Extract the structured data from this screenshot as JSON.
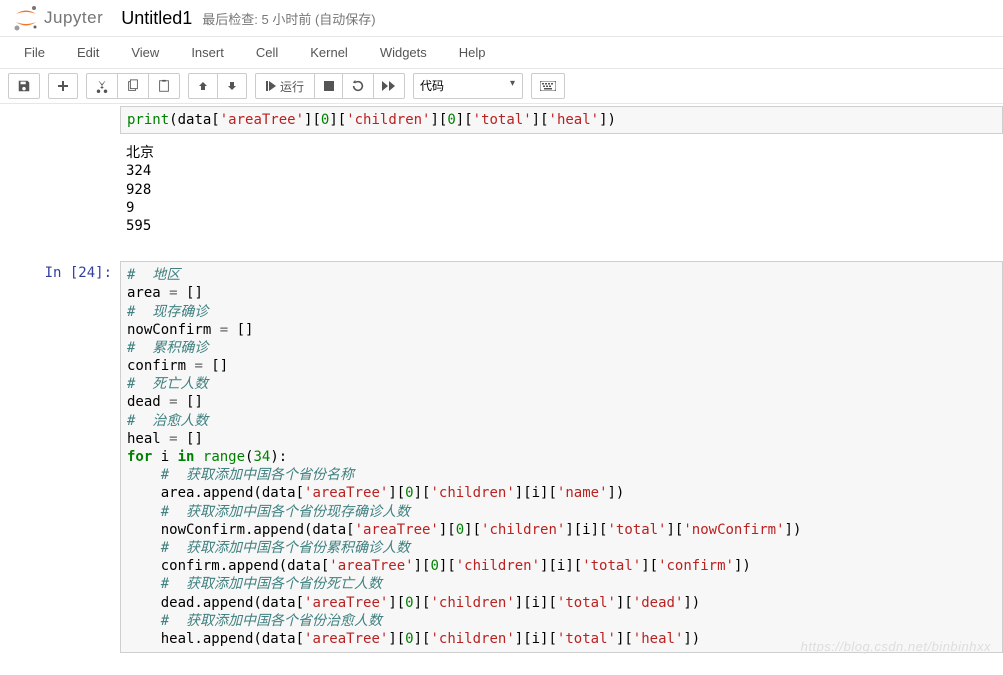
{
  "header": {
    "logo_text": "Jupyter",
    "notebook_name": "Untitled1",
    "checkpoint": "最后检查: 5 小时前   (自动保存)"
  },
  "menubar": [
    "File",
    "Edit",
    "View",
    "Insert",
    "Cell",
    "Kernel",
    "Widgets",
    "Help"
  ],
  "toolbar": {
    "run_label": "运行",
    "cell_type": "代码"
  },
  "cells": [
    {
      "type": "code_fragment",
      "code_html": "<span class='py-builtin'>print</span>(data[<span class='py-string'>'areaTree'</span>][<span class='py-number'>0</span>][<span class='py-string'>'children'</span>][<span class='py-number'>0</span>][<span class='py-string'>'total'</span>][<span class='py-string'>'heal'</span>])",
      "output": "北京\n324\n928\n9\n595"
    },
    {
      "type": "code",
      "prompt": "In [24]:",
      "code_html": "<span class='py-comment'>#  地区</span>\narea <span class='py-op'>=</span> []\n<span class='py-comment'>#  现存确诊</span>\nnowConfirm <span class='py-op'>=</span> []\n<span class='py-comment'>#  累积确诊</span>\nconfirm <span class='py-op'>=</span> []\n<span class='py-comment'>#  死亡人数</span>\ndead <span class='py-op'>=</span> []\n<span class='py-comment'>#  治愈人数</span>\nheal <span class='py-op'>=</span> []\n<span class='py-keyword'>for</span> i <span class='py-keyword'>in</span> <span class='py-builtin'>range</span>(<span class='py-number'>34</span>):\n    <span class='py-comment'>#  获取添加中国各个省份名称</span>\n    area.append(data[<span class='py-string'>'areaTree'</span>][<span class='py-number'>0</span>][<span class='py-string'>'children'</span>][i][<span class='py-string'>'name'</span>])\n    <span class='py-comment'>#  获取添加中国各个省份现存确诊人数</span>\n    nowConfirm.append(data[<span class='py-string'>'areaTree'</span>][<span class='py-number'>0</span>][<span class='py-string'>'children'</span>][i][<span class='py-string'>'total'</span>][<span class='py-string'>'nowConfirm'</span>])\n    <span class='py-comment'>#  获取添加中国各个省份累积确诊人数</span>\n    confirm.append(data[<span class='py-string'>'areaTree'</span>][<span class='py-number'>0</span>][<span class='py-string'>'children'</span>][i][<span class='py-string'>'total'</span>][<span class='py-string'>'confirm'</span>])\n    <span class='py-comment'>#  获取添加中国各个省份死亡人数</span>\n    dead.append(data[<span class='py-string'>'areaTree'</span>][<span class='py-number'>0</span>][<span class='py-string'>'children'</span>][i][<span class='py-string'>'total'</span>][<span class='py-string'>'dead'</span>])\n    <span class='py-comment'>#  获取添加中国各个省份治愈人数</span>\n    heal.append(data[<span class='py-string'>'areaTree'</span>][<span class='py-number'>0</span>][<span class='py-string'>'children'</span>][i][<span class='py-string'>'total'</span>][<span class='py-string'>'heal'</span>])"
    }
  ],
  "watermark": "https://blog.csdn.net/binbinhxx"
}
